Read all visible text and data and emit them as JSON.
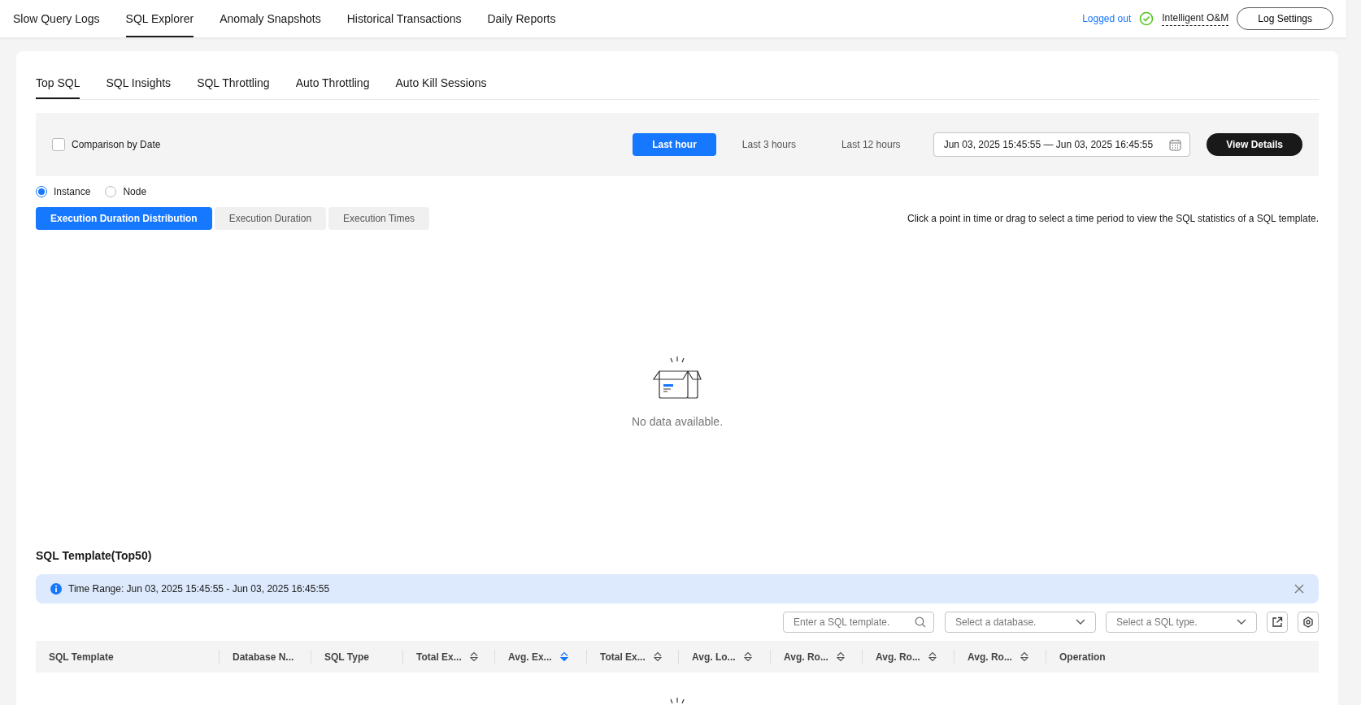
{
  "top_nav": {
    "items": [
      {
        "label": "Slow Query Logs",
        "selected": false
      },
      {
        "label": "SQL Explorer",
        "selected": true
      },
      {
        "label": "Anomaly Snapshots",
        "selected": false
      },
      {
        "label": "Historical Transactions",
        "selected": false
      },
      {
        "label": "Daily Reports",
        "selected": false
      }
    ],
    "status_link": "Logged out",
    "mode_label": "Intelligent O&M",
    "settings_button": "Log Settings"
  },
  "tabs": [
    {
      "label": "Top SQL",
      "selected": true
    },
    {
      "label": "SQL Insights",
      "selected": false
    },
    {
      "label": "SQL Throttling",
      "selected": false
    },
    {
      "label": "Auto Throttling",
      "selected": false
    },
    {
      "label": "Auto Kill Sessions",
      "selected": false
    }
  ],
  "filter": {
    "comparison": {
      "label": "Comparison by Date",
      "checked": false
    },
    "ranges": [
      {
        "label": "Last hour",
        "selected": true
      },
      {
        "label": "Last 3 hours",
        "selected": false
      },
      {
        "label": "Last 12 hours",
        "selected": false
      }
    ],
    "date_range": "Jun 03, 2025 15:45:55 — Jun 03, 2025 16:45:55",
    "view_button": "View Details"
  },
  "scope": [
    {
      "label": "Instance",
      "selected": true
    },
    {
      "label": "Node",
      "selected": false
    }
  ],
  "chart_tabs": [
    {
      "label": "Execution Duration Distribution",
      "selected": true
    },
    {
      "label": "Execution Duration",
      "selected": false
    },
    {
      "label": "Execution Times",
      "selected": false
    }
  ],
  "chart_hint": "Click a point in time or drag to select a time period to view the SQL statistics of a SQL template.",
  "chart_empty": "No data available.",
  "template": {
    "title": "SQL Template(Top50)",
    "alert": "Time Range: Jun 03, 2025 15:45:55 - Jun 03, 2025 16:45:55",
    "search": {
      "placeholder": "Enter a SQL template."
    },
    "database_select": {
      "placeholder": "Select a database."
    },
    "type_select": {
      "placeholder": "Select a SQL type."
    },
    "columns": [
      {
        "label": "SQL Template",
        "kind": "plain"
      },
      {
        "label": "Database N...",
        "kind": "plain"
      },
      {
        "label": "SQL Type",
        "kind": "plain"
      },
      {
        "label": "Total Ex...",
        "kind": "sortable",
        "sorted": false
      },
      {
        "label": "Avg. Ex...",
        "kind": "sortable",
        "sorted": true
      },
      {
        "label": "Total Ex...",
        "kind": "sortable",
        "sorted": false
      },
      {
        "label": "Avg. Lo...",
        "kind": "sortable",
        "sorted": false
      },
      {
        "label": "Avg. Ro...",
        "kind": "sortable",
        "sorted": false
      },
      {
        "label": "Avg. Ro...",
        "kind": "sortable",
        "sorted": false
      },
      {
        "label": "Avg. Ro...",
        "kind": "sortable",
        "sorted": false
      },
      {
        "label": "Operation",
        "kind": "plain"
      }
    ]
  }
}
